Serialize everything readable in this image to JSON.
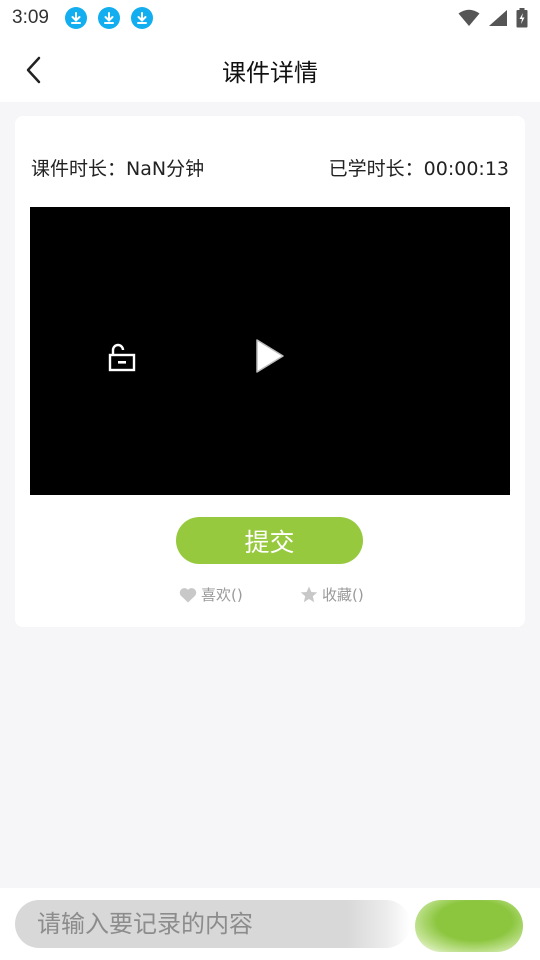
{
  "status_bar": {
    "time": "3:09",
    "download_icons": [
      "download-icon",
      "download-icon",
      "download-icon"
    ],
    "right_icons": [
      "wifi-icon",
      "signal-icon",
      "battery-charging-icon"
    ]
  },
  "header": {
    "title": "课件详情",
    "back_icon": "chevron-left-icon"
  },
  "course": {
    "duration_text": "课件时长：NaN分钟",
    "studied_text": "已学时长：00:00:13"
  },
  "player": {
    "lock_icon": "unlock-icon",
    "play_icon": "play-icon"
  },
  "actions": {
    "submit_label": "提交",
    "like_label": "喜欢()",
    "favorite_label": "收藏()"
  },
  "note": {
    "placeholder": "请输入要记录的内容",
    "send_label": ""
  },
  "colors": {
    "accent_green": "#96c93d",
    "status_icon_blue": "#12aef0",
    "page_bg": "#f6f6f9"
  }
}
